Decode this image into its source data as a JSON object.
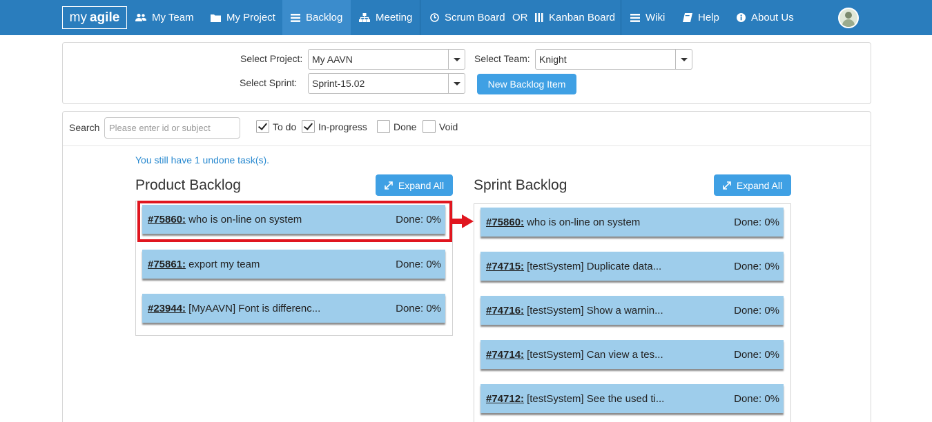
{
  "nav": {
    "logo_text": "my",
    "logo_bold": "agile",
    "items": [
      {
        "label": "My Team",
        "icon": "users-icon"
      },
      {
        "label": "My Project",
        "icon": "folder-icon"
      },
      {
        "label": "Backlog",
        "icon": "list-icon"
      },
      {
        "label": "Meeting",
        "icon": "sitemap-icon"
      },
      {
        "label": "Scrum Board",
        "icon": "clock-icon"
      },
      {
        "label": "Kanban Board",
        "icon": "columns-icon"
      },
      {
        "label": "Wiki",
        "icon": "list-icon"
      },
      {
        "label": "Help",
        "icon": "book-icon"
      },
      {
        "label": "About Us",
        "icon": "info-icon"
      }
    ],
    "or_text": "OR",
    "active": "Backlog"
  },
  "filters": {
    "project_label": "Select Project:",
    "project_value": "My AAVN",
    "team_label": "Select Team:",
    "team_value": "Knight",
    "sprint_label": "Select Sprint:",
    "sprint_value": "Sprint-15.02",
    "new_item_label": "New Backlog Item"
  },
  "search": {
    "label": "Search",
    "placeholder": "Please enter id or subject",
    "statuses": [
      {
        "label": "To do",
        "checked": true
      },
      {
        "label": "In-progress",
        "checked": true
      },
      {
        "label": "Done",
        "checked": false
      },
      {
        "label": "Void",
        "checked": false
      }
    ]
  },
  "notice": "You still have 1 undone task(s).",
  "product_backlog": {
    "title": "Product Backlog",
    "expand_label": "Expand All",
    "items": [
      {
        "id": "#75860:",
        "subject": "who is on-line on system",
        "done": "Done: 0%"
      },
      {
        "id": "#75861:",
        "subject": "export my team",
        "done": "Done: 0%"
      },
      {
        "id": "#23944:",
        "subject": "[MyAAVN] Font is differenc...",
        "done": "Done: 0%"
      }
    ]
  },
  "sprint_backlog": {
    "title": "Sprint Backlog",
    "expand_label": "Expand All",
    "items": [
      {
        "id": "#75860:",
        "subject": "who is on-line on system",
        "done": "Done: 0%"
      },
      {
        "id": "#74715:",
        "subject": "[testSystem] Duplicate data...",
        "done": "Done: 0%"
      },
      {
        "id": "#74716:",
        "subject": "[testSystem] Show a warnin...",
        "done": "Done: 0%"
      },
      {
        "id": "#74714:",
        "subject": "[testSystem] Can view a tes...",
        "done": "Done: 0%"
      },
      {
        "id": "#74712:",
        "subject": "[testSystem] See the used ti...",
        "done": "Done: 0%"
      }
    ]
  },
  "colors": {
    "navbar": "#2a7dbd",
    "button": "#3fa0e4",
    "card": "#9ecdeb",
    "highlight": "#e0161f"
  }
}
